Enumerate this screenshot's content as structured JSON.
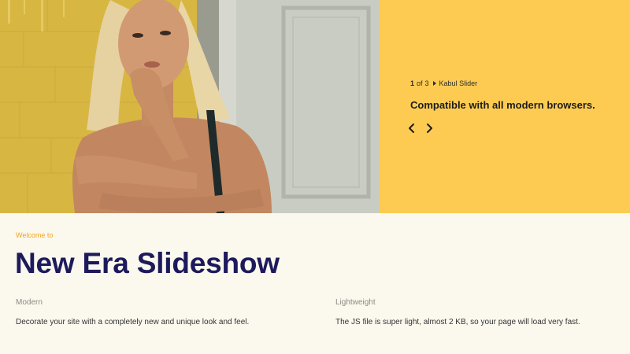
{
  "slider": {
    "current": "1",
    "of_word": "of",
    "total": "3",
    "name": "Kabul Slider",
    "caption": "Compatible with all modern browsers."
  },
  "intro": {
    "eyebrow": "Welcome to",
    "title": "New Era Slideshow"
  },
  "features": [
    {
      "heading": "Modern",
      "text": "Decorate your site with a completely new and unique look and feel."
    },
    {
      "heading": "Lightweight",
      "text": "The JS file is super light, almost 2 KB, so your page will load very fast."
    }
  ],
  "colors": {
    "panel": "#fdcb52",
    "background": "#fbf8ee",
    "title": "#1d1a5c",
    "eyebrow": "#f3a51c",
    "heading": "#8c8a84"
  },
  "icons": {
    "prev": "chevron-left-icon",
    "next": "chevron-right-icon",
    "separator": "play-triangle-icon"
  }
}
